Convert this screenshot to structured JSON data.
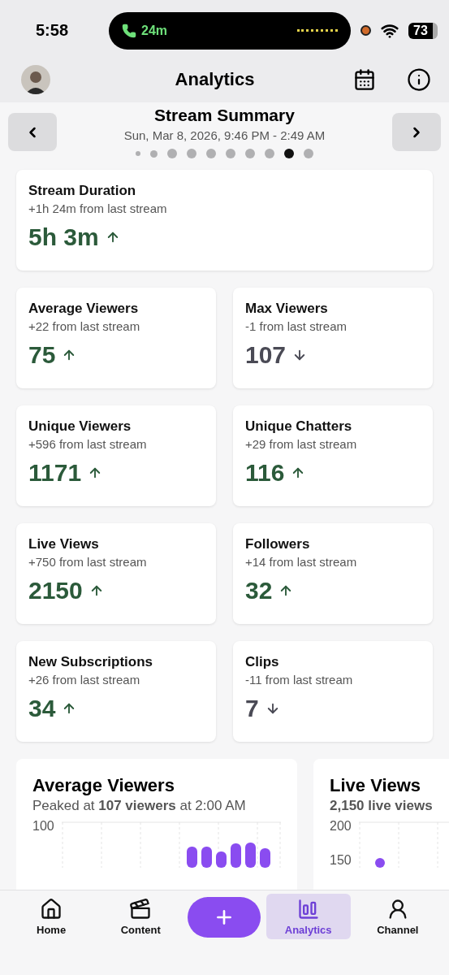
{
  "status_bar": {
    "time": "5:58",
    "call_duration": "24m",
    "battery": "73"
  },
  "header": {
    "title": "Analytics"
  },
  "summary": {
    "title": "Stream Summary",
    "date_range": "Sun, Mar 8, 2026, 9:46 PM - 2:49 AM",
    "pages": [
      {
        "selected": false
      },
      {
        "selected": false
      },
      {
        "selected": false
      },
      {
        "selected": false
      },
      {
        "selected": false
      },
      {
        "selected": false
      },
      {
        "selected": false
      },
      {
        "selected": false
      },
      {
        "selected": true
      },
      {
        "selected": false
      }
    ]
  },
  "featured_stat": {
    "title": "Stream Duration",
    "delta": "+1h 24m from last stream",
    "value": "5h 3m",
    "up": true
  },
  "stats": [
    {
      "title": "Average Viewers",
      "delta": "+22 from last stream",
      "value": "75",
      "up": true
    },
    {
      "title": "Max Viewers",
      "delta": "-1 from last stream",
      "value": "107",
      "up": false
    },
    {
      "title": "Unique Viewers",
      "delta": "+596 from last stream",
      "value": "1171",
      "up": true
    },
    {
      "title": "Unique Chatters",
      "delta": "+29 from last stream",
      "value": "116",
      "up": true
    },
    {
      "title": "Live Views",
      "delta": "+750 from last stream",
      "value": "2150",
      "up": true
    },
    {
      "title": "Followers",
      "delta": "+14 from last stream",
      "value": "32",
      "up": true
    },
    {
      "title": "New Subscriptions",
      "delta": "+26 from last stream",
      "value": "34",
      "up": true
    },
    {
      "title": "Clips",
      "delta": "-11 from last stream",
      "value": "7",
      "up": false
    }
  ],
  "chart_cards": [
    {
      "title": "Average Viewers",
      "subtitle": "Peaked at **107 viewers** at 2:00 AM",
      "kind": "bars",
      "y_ticks": [
        "100"
      ]
    },
    {
      "title": "Live Views",
      "subtitle": "2,150 live views",
      "kind": "dots",
      "y_ticks": [
        "200",
        "150"
      ]
    }
  ],
  "tab_bar": [
    {
      "kind": "tab",
      "label": "Home",
      "selected": false
    },
    {
      "kind": "tab",
      "label": "Content",
      "selected": false
    },
    {
      "kind": "action"
    },
    {
      "kind": "tab",
      "label": "Analytics",
      "selected": true
    },
    {
      "kind": "tab",
      "label": "Channel",
      "selected": false
    }
  ]
}
